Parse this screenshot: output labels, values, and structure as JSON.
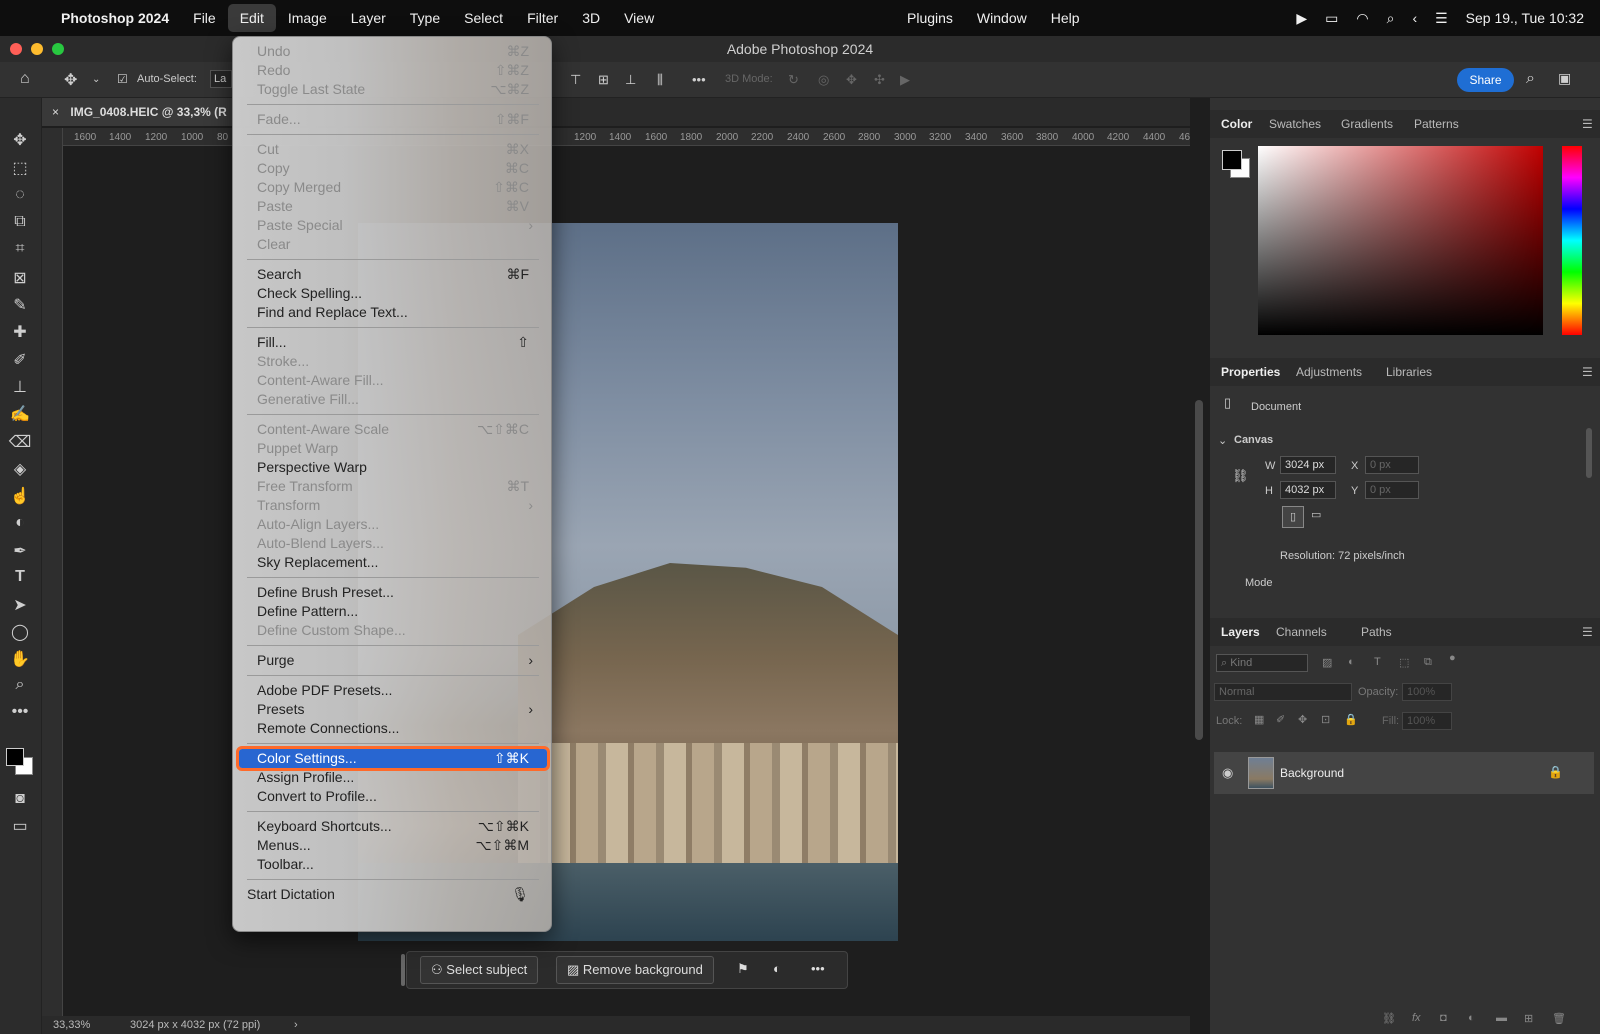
{
  "menubar": {
    "app": "Photoshop 2024",
    "items": [
      "File",
      "Edit",
      "Image",
      "Layer",
      "Type",
      "Select",
      "Filter",
      "3D",
      "View"
    ],
    "center_items": [
      "Plugins",
      "Window",
      "Help"
    ],
    "datetime": "Sep 19., Tue  10:32"
  },
  "window": {
    "title": "Adobe Photoshop 2024"
  },
  "options": {
    "auto_select": "Auto-Select:",
    "auto_select_value": "La",
    "mode_3d": "3D Mode:",
    "share": "Share"
  },
  "document": {
    "tab": "IMG_0408.HEIC @ 33,3% (R"
  },
  "ruler": {
    "left_labels": [
      "1600",
      "1400",
      "1200",
      "1000",
      "80"
    ],
    "right_labels": [
      "1200",
      "1400",
      "1600",
      "1800",
      "2000",
      "2200",
      "2400",
      "2600",
      "2800",
      "3000",
      "3200",
      "3400",
      "3600",
      "3800",
      "4000",
      "4200",
      "4400",
      "46"
    ]
  },
  "edit_menu": {
    "groups": [
      [
        {
          "label": "Undo",
          "shortcut": "⌘Z",
          "disabled": true
        },
        {
          "label": "Redo",
          "shortcut": "⇧⌘Z",
          "disabled": true
        },
        {
          "label": "Toggle Last State",
          "shortcut": "⌥⌘Z",
          "disabled": true
        }
      ],
      [
        {
          "label": "Fade...",
          "shortcut": "⇧⌘F",
          "disabled": true
        }
      ],
      [
        {
          "label": "Cut",
          "shortcut": "⌘X",
          "disabled": true
        },
        {
          "label": "Copy",
          "shortcut": "⌘C",
          "disabled": true
        },
        {
          "label": "Copy Merged",
          "shortcut": "⇧⌘C",
          "disabled": true
        },
        {
          "label": "Paste",
          "shortcut": "⌘V",
          "disabled": true
        },
        {
          "label": "Paste Special",
          "shortcut": "",
          "submenu": true,
          "disabled": true
        },
        {
          "label": "Clear",
          "shortcut": "",
          "disabled": true
        }
      ],
      [
        {
          "label": "Search",
          "shortcut": "⌘F",
          "disabled": false
        },
        {
          "label": "Check Spelling...",
          "shortcut": "",
          "disabled": false
        },
        {
          "label": "Find and Replace Text...",
          "shortcut": "",
          "disabled": false
        }
      ],
      [
        {
          "label": "Fill...",
          "shortcut": "⇧",
          "disabled": false
        },
        {
          "label": "Stroke...",
          "shortcut": "",
          "disabled": true
        },
        {
          "label": "Content-Aware Fill...",
          "shortcut": "",
          "disabled": true
        },
        {
          "label": "Generative Fill...",
          "shortcut": "",
          "disabled": true
        }
      ],
      [
        {
          "label": "Content-Aware Scale",
          "shortcut": "⌥⇧⌘C",
          "disabled": true
        },
        {
          "label": "Puppet Warp",
          "shortcut": "",
          "disabled": true
        },
        {
          "label": "Perspective Warp",
          "shortcut": "",
          "disabled": false
        },
        {
          "label": "Free Transform",
          "shortcut": "⌘T",
          "disabled": true
        },
        {
          "label": "Transform",
          "shortcut": "",
          "submenu": true,
          "disabled": true
        },
        {
          "label": "Auto-Align Layers...",
          "shortcut": "",
          "disabled": true
        },
        {
          "label": "Auto-Blend Layers...",
          "shortcut": "",
          "disabled": true
        },
        {
          "label": "Sky Replacement...",
          "shortcut": "",
          "disabled": false
        }
      ],
      [
        {
          "label": "Define Brush Preset...",
          "shortcut": "",
          "disabled": false
        },
        {
          "label": "Define Pattern...",
          "shortcut": "",
          "disabled": false
        },
        {
          "label": "Define Custom Shape...",
          "shortcut": "",
          "disabled": true
        }
      ],
      [
        {
          "label": "Purge",
          "shortcut": "",
          "submenu": true,
          "disabled": false
        }
      ],
      [
        {
          "label": "Adobe PDF Presets...",
          "shortcut": "",
          "disabled": false
        },
        {
          "label": "Presets",
          "shortcut": "",
          "submenu": true,
          "disabled": false
        },
        {
          "label": "Remote Connections...",
          "shortcut": "",
          "disabled": false
        }
      ],
      [
        {
          "label": "Color Settings...",
          "shortcut": "⇧⌘K",
          "disabled": false,
          "highlighted": true
        },
        {
          "label": "Assign Profile...",
          "shortcut": "",
          "disabled": false
        },
        {
          "label": "Convert to Profile...",
          "shortcut": "",
          "disabled": false
        }
      ],
      [
        {
          "label": "Keyboard Shortcuts...",
          "shortcut": "⌥⇧⌘K",
          "disabled": false
        },
        {
          "label": "Menus...",
          "shortcut": "⌥⇧⌘M",
          "disabled": false
        },
        {
          "label": "Toolbar...",
          "shortcut": "",
          "disabled": false
        }
      ],
      [
        {
          "label": "Start Dictation",
          "shortcut": "🎙",
          "disabled": false,
          "outdent": true
        }
      ]
    ]
  },
  "taskbar": {
    "select_subject": "Select subject",
    "remove_background": "Remove background"
  },
  "status": {
    "zoom": "33,33%",
    "info": "3024 px x 4032 px (72 ppi)"
  },
  "color_panel": {
    "tabs": [
      "Color",
      "Swatches",
      "Gradients",
      "Patterns"
    ]
  },
  "properties_panel": {
    "tabs": [
      "Properties",
      "Adjustments",
      "Libraries"
    ],
    "doc_label": "Document",
    "canvas_label": "Canvas",
    "w_label": "W",
    "w_value": "3024 px",
    "h_label": "H",
    "h_value": "4032 px",
    "x_label": "X",
    "x_value": "0 px",
    "y_label": "Y",
    "y_value": "0 px",
    "resolution": "Resolution: 72 pixels/inch",
    "mode_label": "Mode"
  },
  "layers_panel": {
    "tabs": [
      "Layers",
      "Channels",
      "Paths"
    ],
    "kind": "Kind",
    "blend": "Normal",
    "opacity_label": "Opacity:",
    "opacity_value": "100%",
    "lock_label": "Lock:",
    "fill_label": "Fill:",
    "fill_value": "100%",
    "layer_name": "Background"
  },
  "colors": {
    "accent": "#2866d1",
    "highlight_outline": "#ff6a2a",
    "share": "#1f6ed4"
  }
}
